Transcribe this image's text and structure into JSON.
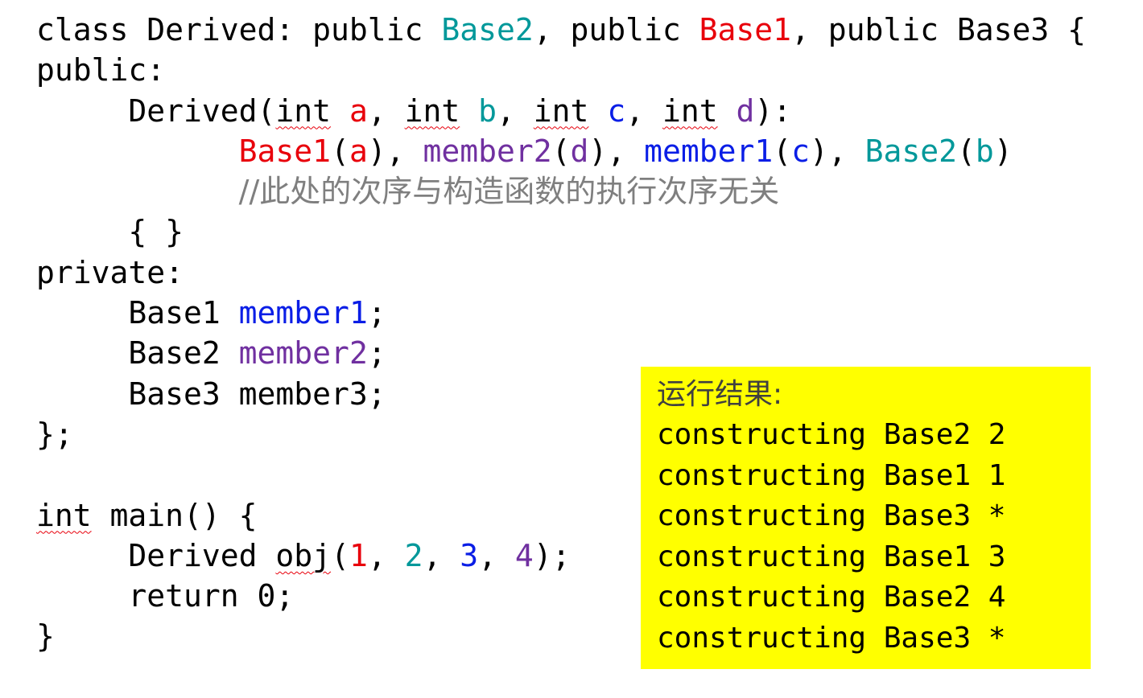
{
  "code": {
    "lines": [
      [
        {
          "t": "class Derived: public ",
          "c": "plain"
        },
        {
          "t": "Base2",
          "c": "teal"
        },
        {
          "t": ", public ",
          "c": "plain"
        },
        {
          "t": "Base1",
          "c": "red"
        },
        {
          "t": ", public Base3 {",
          "c": "plain"
        }
      ],
      [
        {
          "t": "public:",
          "c": "plain"
        }
      ],
      [
        {
          "t": "     Derived(",
          "c": "plain"
        },
        {
          "t": "int",
          "c": "plain",
          "squig": true
        },
        {
          "t": " ",
          "c": "plain"
        },
        {
          "t": "a",
          "c": "red"
        },
        {
          "t": ", ",
          "c": "plain"
        },
        {
          "t": "int",
          "c": "plain",
          "squig": true
        },
        {
          "t": " ",
          "c": "plain"
        },
        {
          "t": "b",
          "c": "teal"
        },
        {
          "t": ", ",
          "c": "plain"
        },
        {
          "t": "int",
          "c": "plain",
          "squig": true
        },
        {
          "t": " ",
          "c": "plain"
        },
        {
          "t": "c",
          "c": "blue"
        },
        {
          "t": ", ",
          "c": "plain"
        },
        {
          "t": "int",
          "c": "plain",
          "squig": true
        },
        {
          "t": " ",
          "c": "plain"
        },
        {
          "t": "d",
          "c": "purple"
        },
        {
          "t": "):",
          "c": "plain"
        }
      ],
      [
        {
          "t": "           ",
          "c": "plain"
        },
        {
          "t": "Base1",
          "c": "red"
        },
        {
          "t": "(",
          "c": "plain"
        },
        {
          "t": "a",
          "c": "red"
        },
        {
          "t": "), ",
          "c": "plain"
        },
        {
          "t": "member2",
          "c": "purple"
        },
        {
          "t": "(",
          "c": "plain"
        },
        {
          "t": "d",
          "c": "purple"
        },
        {
          "t": "), ",
          "c": "plain"
        },
        {
          "t": "member1",
          "c": "blue"
        },
        {
          "t": "(",
          "c": "plain"
        },
        {
          "t": "c",
          "c": "blue"
        },
        {
          "t": "), ",
          "c": "plain"
        },
        {
          "t": "Base2",
          "c": "teal"
        },
        {
          "t": "(",
          "c": "plain"
        },
        {
          "t": "b",
          "c": "teal"
        },
        {
          "t": ")",
          "c": "plain"
        }
      ],
      [
        {
          "t": "           ",
          "c": "plain"
        },
        {
          "t": "//此处的次序与构造函数的执行次序无关",
          "c": "comment"
        }
      ],
      [
        {
          "t": "     { }",
          "c": "plain"
        }
      ],
      [
        {
          "t": "private:",
          "c": "plain"
        }
      ],
      [
        {
          "t": "     Base1 ",
          "c": "plain"
        },
        {
          "t": "member1",
          "c": "blue"
        },
        {
          "t": ";",
          "c": "plain"
        }
      ],
      [
        {
          "t": "     Base2 ",
          "c": "plain"
        },
        {
          "t": "member2",
          "c": "purple"
        },
        {
          "t": ";",
          "c": "plain"
        }
      ],
      [
        {
          "t": "     Base3 member3;",
          "c": "plain"
        }
      ],
      [
        {
          "t": "};",
          "c": "plain"
        }
      ],
      [
        {
          "t": "",
          "c": "plain"
        }
      ],
      [
        {
          "t": "int",
          "c": "plain",
          "squig": true
        },
        {
          "t": " main() {",
          "c": "plain"
        }
      ],
      [
        {
          "t": "     Derived ",
          "c": "plain"
        },
        {
          "t": "obj",
          "c": "plain",
          "squig": true
        },
        {
          "t": "(",
          "c": "plain"
        },
        {
          "t": "1",
          "c": "red"
        },
        {
          "t": ", ",
          "c": "plain"
        },
        {
          "t": "2",
          "c": "teal"
        },
        {
          "t": ", ",
          "c": "plain"
        },
        {
          "t": "3",
          "c": "blue"
        },
        {
          "t": ", ",
          "c": "plain"
        },
        {
          "t": "4",
          "c": "purple"
        },
        {
          "t": ");",
          "c": "plain"
        }
      ],
      [
        {
          "t": "     return 0;",
          "c": "plain"
        }
      ],
      [
        {
          "t": "}",
          "c": "plain"
        }
      ]
    ]
  },
  "result": {
    "title": "运行结果:",
    "lines": [
      "constructing Base2 2",
      "constructing Base1 1",
      "constructing Base3 *",
      "constructing Base1 3",
      "constructing Base2 4",
      "constructing Base3 *"
    ]
  },
  "colors": {
    "red": "#e8000b",
    "teal": "#00989a",
    "blue": "#0a1ee6",
    "purple": "#7030a0",
    "comment": "#7f7f7f",
    "highlight": "#ffff00"
  }
}
